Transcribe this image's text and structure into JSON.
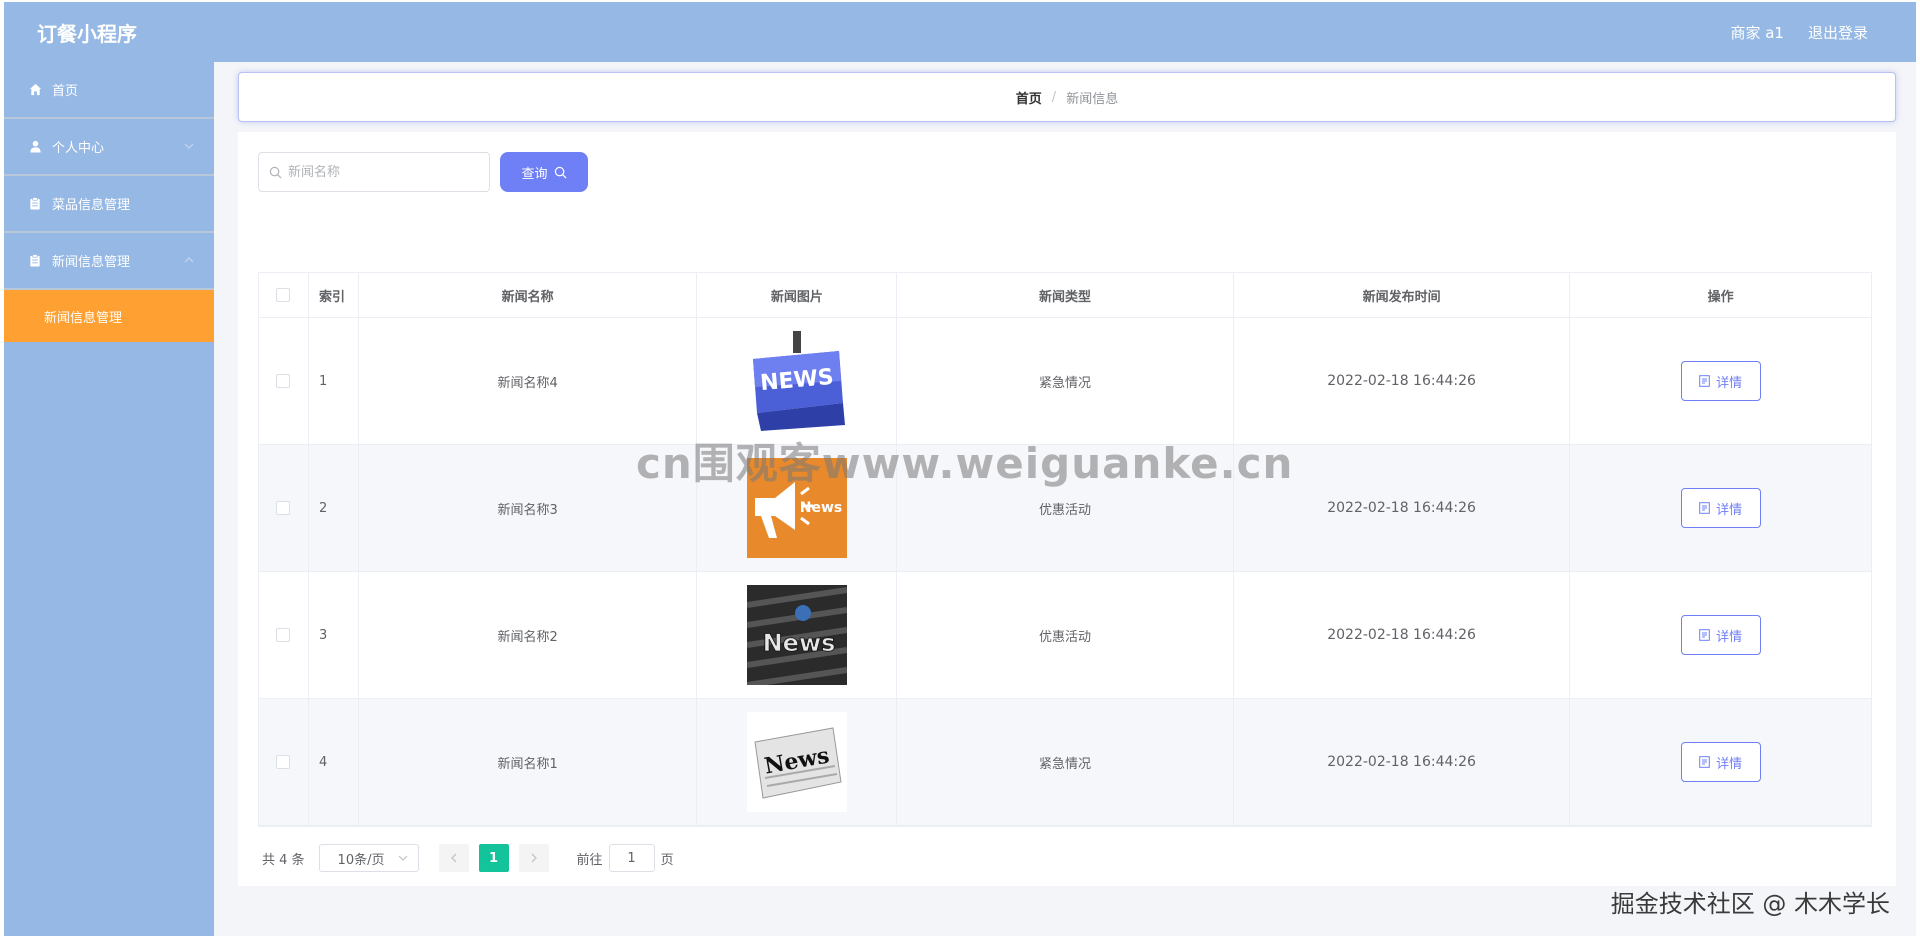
{
  "app": {
    "title": "订餐小程序"
  },
  "header": {
    "user_label": "商家 a1",
    "logout_label": "退出登录"
  },
  "sidebar": {
    "items": [
      {
        "label": "首页",
        "icon": "home-icon"
      },
      {
        "label": "个人中心",
        "icon": "user-icon"
      },
      {
        "label": "菜品信息管理",
        "icon": "clipboard-icon"
      },
      {
        "label": "新闻信息管理",
        "icon": "clipboard-icon"
      }
    ],
    "active_sub": "新闻信息管理"
  },
  "breadcrumb": {
    "home": "首页",
    "separator": "/",
    "current": "新闻信息"
  },
  "search": {
    "placeholder": "新闻名称",
    "value": "",
    "button_label": "查询"
  },
  "table": {
    "headers": [
      "索引",
      "新闻名称",
      "新闻图片",
      "新闻类型",
      "新闻发布时间",
      "操作"
    ],
    "rows": [
      {
        "index": "1",
        "name": "新闻名称4",
        "image": "news-keyboard-key",
        "type": "紧急情况",
        "time": "2022-02-18 16:44:26",
        "action": "详情"
      },
      {
        "index": "2",
        "name": "新闻名称3",
        "image": "news-megaphone-orange",
        "type": "优惠活动",
        "time": "2022-02-18 16:44:26",
        "action": "详情"
      },
      {
        "index": "3",
        "name": "新闻名称2",
        "image": "news-dark-words",
        "type": "优惠活动",
        "time": "2022-02-18 16:44:26",
        "action": "详情"
      },
      {
        "index": "4",
        "name": "新闻名称1",
        "image": "news-newspaper",
        "type": "紧急情况",
        "time": "2022-02-18 16:44:26",
        "action": "详情"
      }
    ]
  },
  "pagination": {
    "total_label": "共 4 条",
    "page_size": "10条/页",
    "current_page": "1",
    "goto_label": "前往",
    "goto_value": "1",
    "page_suffix": "页"
  },
  "watermarks": {
    "center": "cn围观客www.weiguanke.cn",
    "corner": "掘金技术社区 @ 木木学长"
  },
  "colors": {
    "sidebar": "#96b8e4",
    "active_menu": "#ffa033",
    "accent": "#6f7ff6",
    "page_active": "#13c39a"
  }
}
